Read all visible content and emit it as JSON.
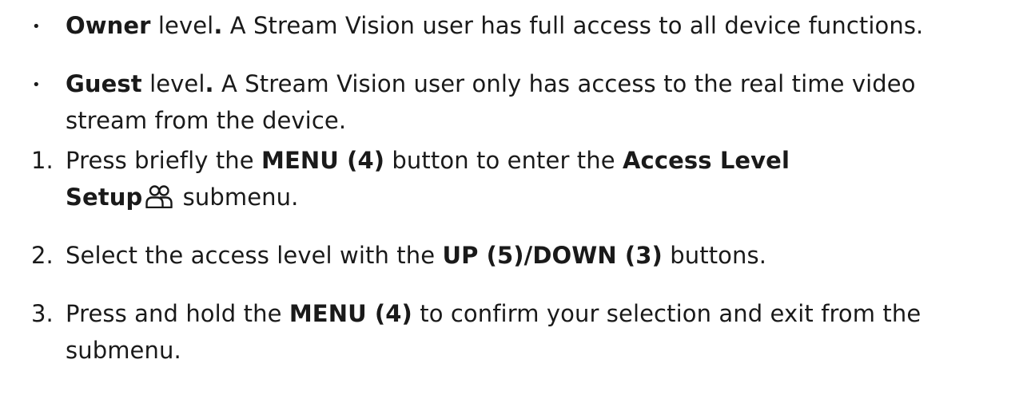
{
  "bullets": [
    {
      "term": "Owner",
      "text_a": " level",
      "punct": ".",
      "text_b": "  A Stream Vision user has full access to all device functions."
    },
    {
      "term": "Guest",
      "text_a": " level",
      "punct": ".",
      "text_b": " A Stream Vision user only has access to the real time video",
      "cont": "stream from the device."
    }
  ],
  "steps": [
    {
      "number": "1.",
      "p1": "Press briefly the ",
      "b1": "MENU (4)",
      "p2": " button to enter the ",
      "b2": "Access Level",
      "b3": "Setup",
      "icon": "users-icon",
      "p3": " submenu."
    },
    {
      "number": "2.",
      "p1": "Select the access level with the ",
      "b1": "UP (5)/DOWN (3)",
      "p2": " buttons."
    },
    {
      "number": "3.",
      "p1": "Press and hold the ",
      "b1": "MENU (4)",
      "p2": " to confirm your selection and exit from the",
      "cont": "submenu."
    }
  ]
}
